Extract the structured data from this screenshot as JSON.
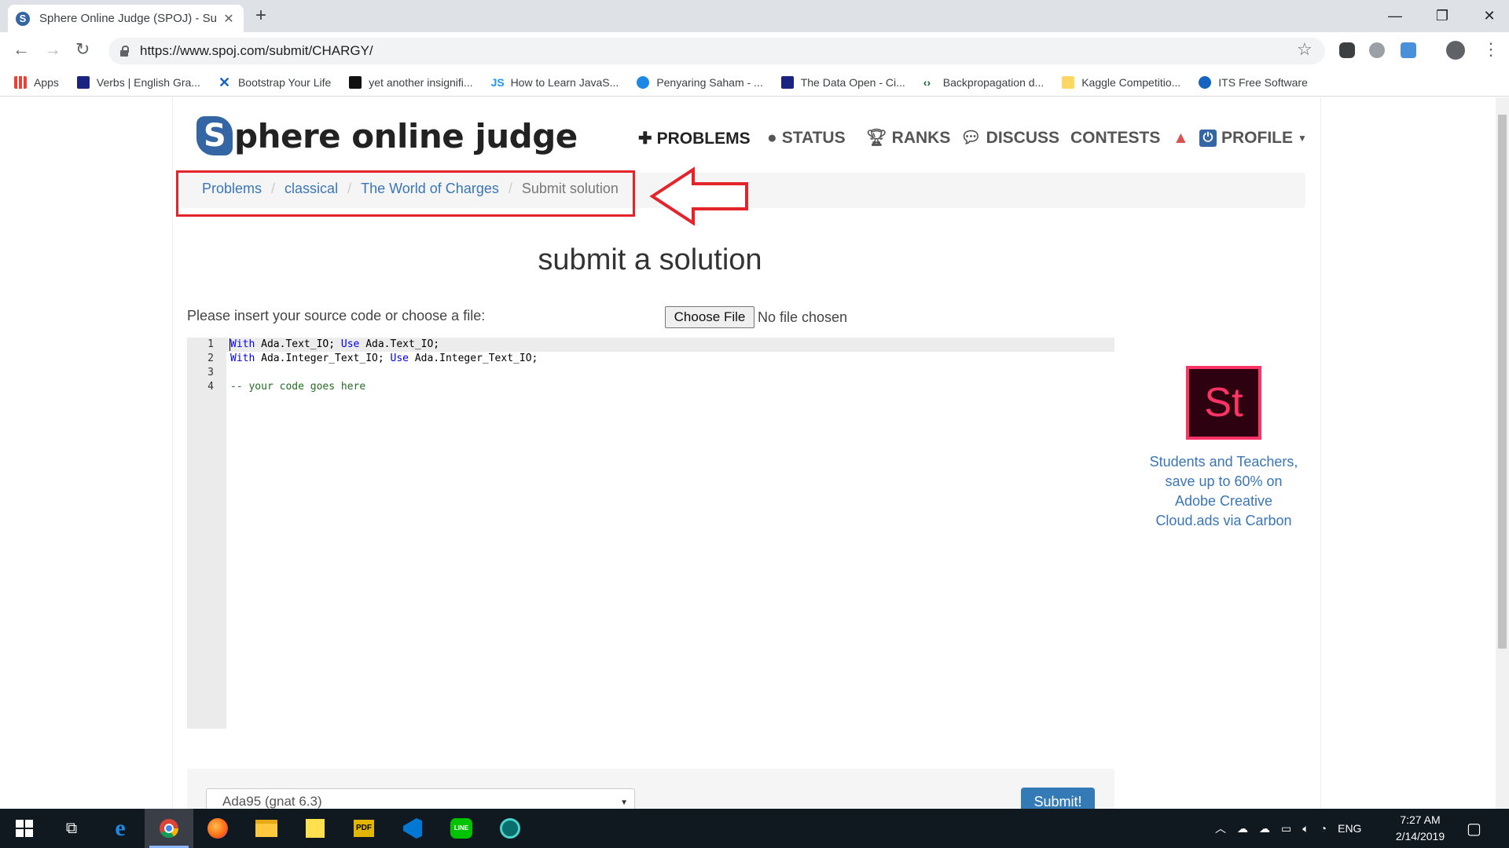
{
  "browser": {
    "tab_title": "Sphere Online Judge (SPOJ) - Su",
    "url": "https://www.spoj.com/submit/CHARGY/",
    "bookmarks": [
      {
        "label": "Apps",
        "icon": "apps-grid-icon",
        "color": "#4285f4"
      },
      {
        "label": "Verbs | English Gra...",
        "icon": "ef-icon",
        "color": "#1a237e"
      },
      {
        "label": "Bootstrap Your Life",
        "icon": "x-icon",
        "color": "#1565c0"
      },
      {
        "label": "yet another insignifi...",
        "icon": "terminal-icon",
        "color": "#111111"
      },
      {
        "label": "How to Learn JavaS...",
        "icon": "js-icon",
        "color": "#2196f3"
      },
      {
        "label": "Penyaring Saham - ...",
        "icon": "cloud-icon",
        "color": "#1e88e5"
      },
      {
        "label": "The Data Open - Ci...",
        "icon": "flag-icon",
        "color": "#1a237e"
      },
      {
        "label": "Backpropagation d...",
        "icon": "code-icon",
        "color": "#0d652d"
      },
      {
        "label": "Kaggle Competitio...",
        "icon": "folder-icon",
        "color": "#fdd663"
      },
      {
        "label": "ITS Free Software",
        "icon": "its-icon",
        "color": "#1565c0"
      }
    ]
  },
  "site": {
    "logo_letter": "S",
    "logo_text": "phere online judge",
    "nav": [
      {
        "label": "PROBLEMS",
        "icon": "puzzle-icon"
      },
      {
        "label": "STATUS",
        "icon": "circle-icon"
      },
      {
        "label": "RANKS",
        "icon": "trophy-icon"
      },
      {
        "label": "DISCUSS",
        "icon": "comments-icon"
      },
      {
        "label": "CONTESTS",
        "icon": ""
      },
      {
        "label": "PROFILE",
        "icon": "power-icon"
      }
    ]
  },
  "breadcrumb": [
    "Problems",
    "classical",
    "The World of Charges",
    "Submit solution"
  ],
  "heading": "submit a solution",
  "form": {
    "prompt": "Please insert your source code or choose a file:",
    "choose_file": "Choose File",
    "no_file": "No file chosen",
    "language": "Ada95 (gnat 6.3)",
    "submit": "Submit!"
  },
  "code_lines": [
    {
      "n": "1",
      "kw1": "With",
      "t1": " Ada.Text_IO; ",
      "kw2": "Use",
      "t2": " Ada.Text_IO;",
      "comment": ""
    },
    {
      "n": "2",
      "kw1": "With",
      "t1": " Ada.Integer_Text_IO; ",
      "kw2": "Use",
      "t2": " Ada.Integer_Text_IO;",
      "comment": ""
    },
    {
      "n": "3",
      "kw1": "",
      "t1": "",
      "kw2": "",
      "t2": "",
      "comment": ""
    },
    {
      "n": "4",
      "kw1": "",
      "t1": "",
      "kw2": "",
      "t2": "",
      "comment": "-- your code goes here"
    }
  ],
  "ad": {
    "logo": "St",
    "text": "Students and Teachers, save up to 60% on Adobe Creative Cloud.ads via Carbon"
  },
  "taskbar": {
    "lang": "ENG",
    "time": "7:27 AM",
    "date": "2/14/2019"
  },
  "colors": {
    "accent": "#3465a4",
    "link": "#3a76b6",
    "annotation": "#e3242b"
  }
}
